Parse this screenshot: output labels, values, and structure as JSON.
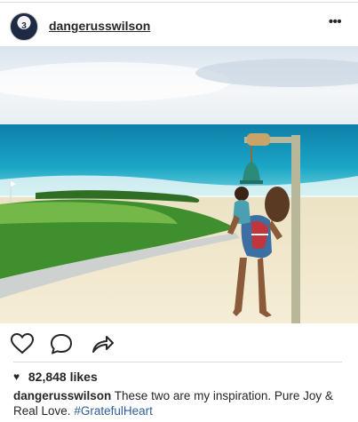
{
  "post": {
    "username": "dangerusswilson",
    "avatar_number": "3",
    "more_icon": "•••",
    "likes_heart": "♥",
    "likes_text": "82,848 likes",
    "caption": {
      "username": "dangerusswilson",
      "text": "These two are my inspiration. Pure Joy & Real Love.",
      "hashtag": "#GratefulHeart"
    }
  },
  "icons": {
    "like": "heart-outline-icon",
    "comment": "speech-bubble-icon",
    "share": "share-arrow-icon"
  },
  "colors": {
    "text": "#262626",
    "hashtag": "#2f5f9a",
    "divider": "#dbdbdb"
  }
}
